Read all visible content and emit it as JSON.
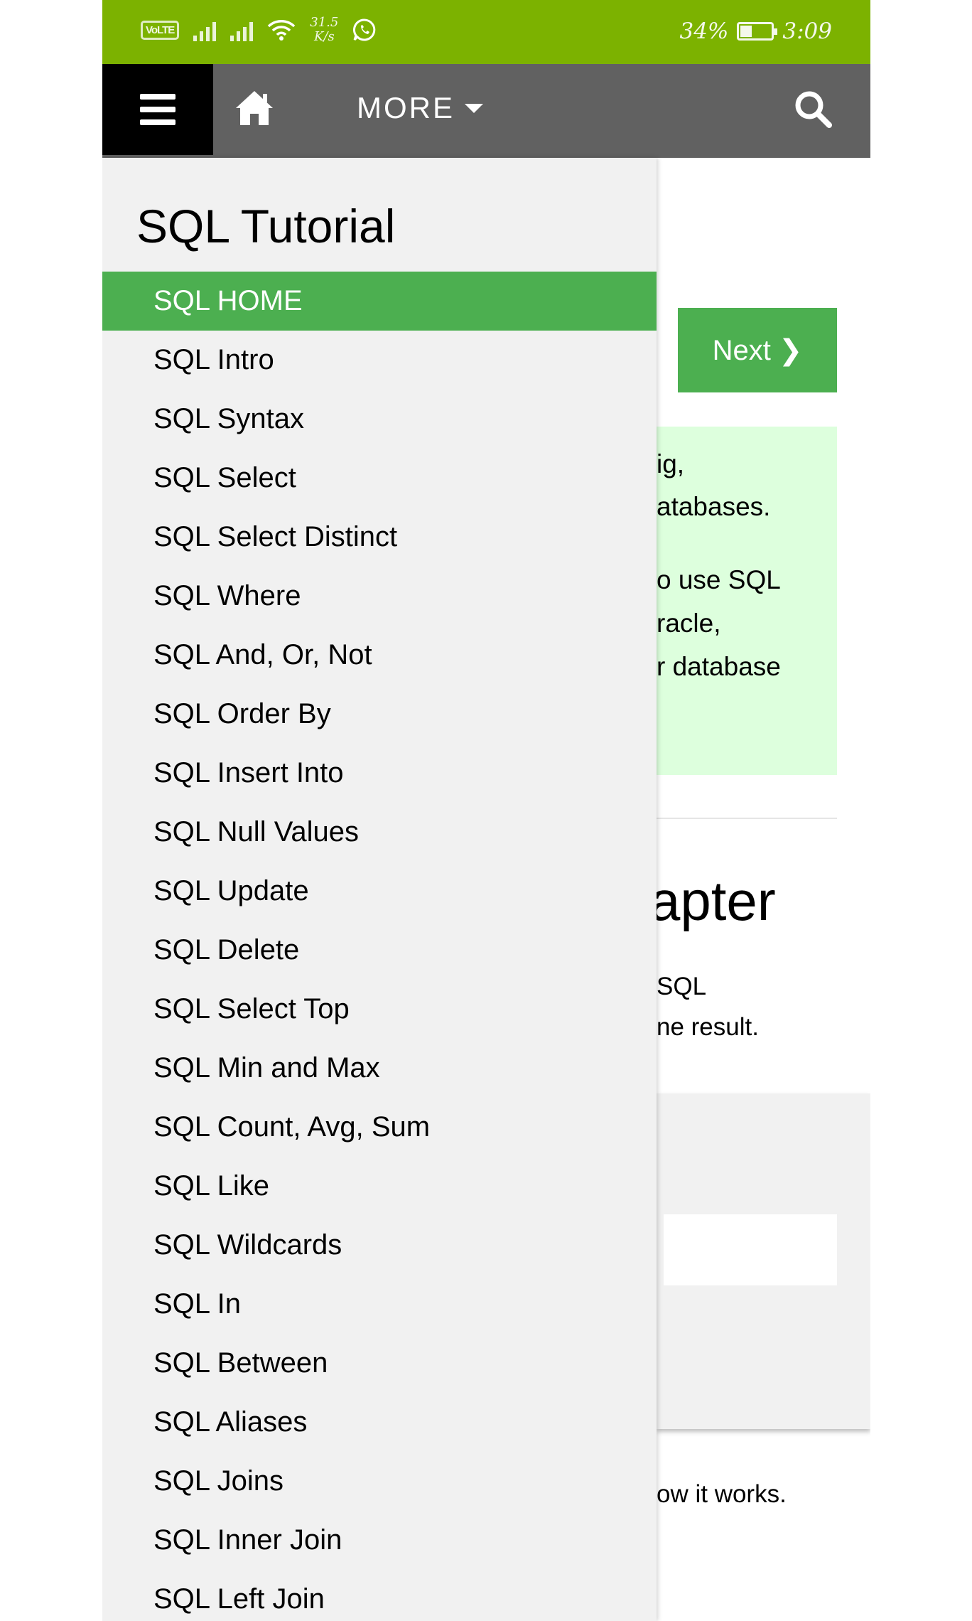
{
  "status_bar": {
    "volte": "VoLTE",
    "speed_value": "31.5",
    "speed_unit": "K/s",
    "battery": "34%",
    "battery_level": 0.34,
    "time": "3:09",
    "color": "#7cb200"
  },
  "navbar": {
    "more_label": "MORE",
    "icons": [
      "menu-icon",
      "home-icon",
      "caret-down-icon",
      "search-icon"
    ],
    "color": "#616161"
  },
  "sidebar": {
    "title": "SQL Tutorial",
    "active_color": "#4caf50",
    "items": [
      {
        "label": "SQL HOME",
        "active": true
      },
      {
        "label": "SQL Intro"
      },
      {
        "label": "SQL Syntax"
      },
      {
        "label": "SQL Select"
      },
      {
        "label": "SQL Select Distinct"
      },
      {
        "label": "SQL Where"
      },
      {
        "label": "SQL And, Or, Not"
      },
      {
        "label": "SQL Order By"
      },
      {
        "label": "SQL Insert Into"
      },
      {
        "label": "SQL Null Values"
      },
      {
        "label": "SQL Update"
      },
      {
        "label": "SQL Delete"
      },
      {
        "label": "SQL Select Top"
      },
      {
        "label": "SQL Min and Max"
      },
      {
        "label": "SQL Count, Avg, Sum"
      },
      {
        "label": "SQL Like"
      },
      {
        "label": "SQL Wildcards"
      },
      {
        "label": "SQL In"
      },
      {
        "label": "SQL Between"
      },
      {
        "label": "SQL Aliases"
      },
      {
        "label": "SQL Joins"
      },
      {
        "label": "SQL Inner Join"
      },
      {
        "label": "SQL Left Join"
      }
    ]
  },
  "content": {
    "next_label": "Next ❯",
    "note_lines": [
      "ig,",
      "atabases.",
      "o use SQL",
      "racle,",
      "r database"
    ],
    "chapter_heading": "apter",
    "chapter_lines": [
      "SQL",
      "ne result."
    ],
    "works_text": "ow it works."
  }
}
